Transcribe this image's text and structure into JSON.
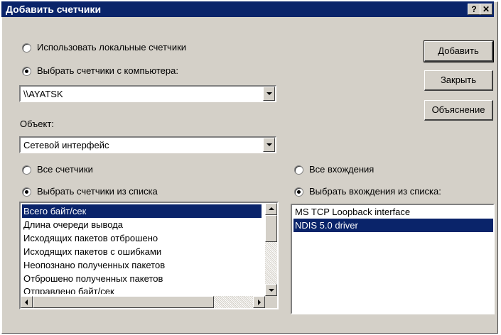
{
  "window": {
    "title": "Добавить счетчики",
    "help_label": "?",
    "close_label": "✕"
  },
  "source": {
    "local_label": "Использовать локальные счетчики",
    "computer_label": "Выбрать счетчики с компьютера:",
    "computer_value": "\\\\AYATSK"
  },
  "object": {
    "label": "Объект:",
    "value": "Сетевой интерфейс"
  },
  "counters": {
    "all_label": "Все счетчики",
    "select_label": "Выбрать счетчики из списка",
    "items": [
      "Всего байт/сек",
      "Длина очереди вывода",
      "Исходящих пакетов отброшено",
      "Исходящих пакетов с ошибками",
      "Неопознано полученных пакетов",
      "Отброшено полученных пакетов",
      "Отправлено байт/сек"
    ],
    "selected_index": 0
  },
  "instances": {
    "all_label": "Все вхождения",
    "select_label": "Выбрать вхождения из списка:",
    "items": [
      "MS TCP Loopback interface",
      "NDIS 5.0 driver"
    ],
    "selected_index": 1
  },
  "buttons": {
    "add": "Добавить",
    "close": "Закрыть",
    "explain": "Объяснение"
  }
}
